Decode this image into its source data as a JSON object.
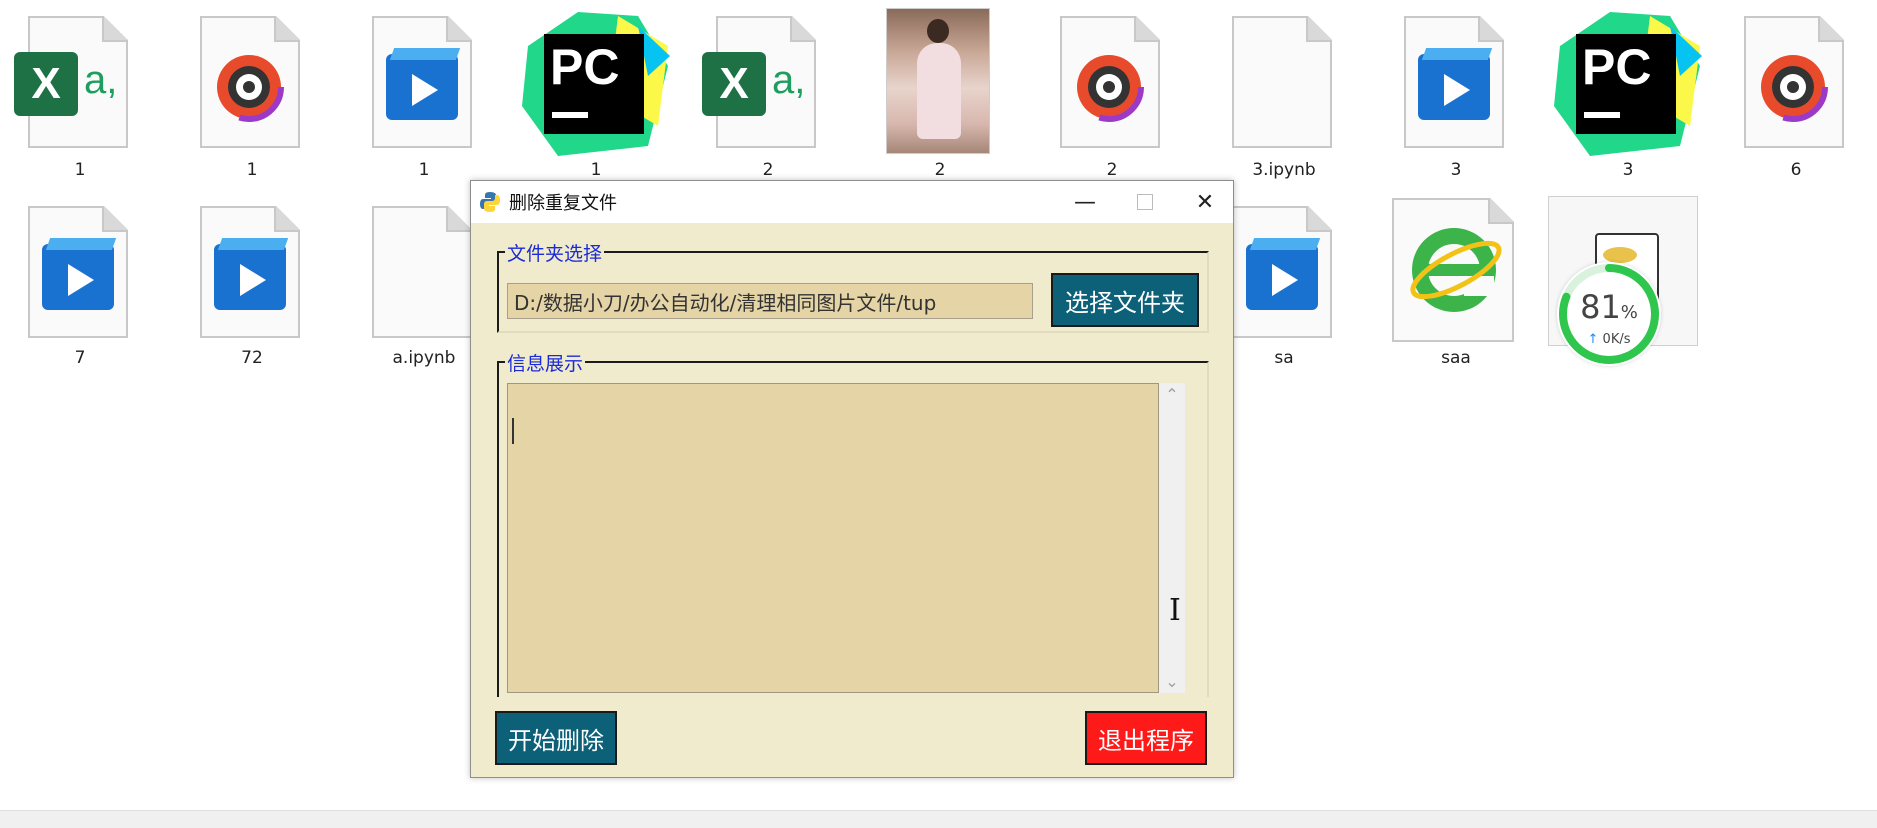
{
  "desktop": {
    "files": [
      {
        "label": "1",
        "icon": "excel-icon"
      },
      {
        "label": "1",
        "icon": "audio-icon"
      },
      {
        "label": "1",
        "icon": "video-icon"
      },
      {
        "label": "1",
        "icon": "pycharm-icon"
      },
      {
        "label": "2",
        "icon": "excel-icon"
      },
      {
        "label": "2",
        "icon": "photo-thumbnail"
      },
      {
        "label": "2",
        "icon": "audio-icon"
      },
      {
        "label": "3.ipynb",
        "icon": "blank-file-icon"
      },
      {
        "label": "3",
        "icon": "video-icon"
      },
      {
        "label": "3",
        "icon": "pycharm-icon"
      },
      {
        "label": "6",
        "icon": "audio-icon"
      },
      {
        "label": "7",
        "icon": "video-icon"
      },
      {
        "label": "72",
        "icon": "video-icon"
      },
      {
        "label": "a.ipynb",
        "icon": "blank-file-icon"
      },
      {
        "label": "sa",
        "icon": "video-icon"
      },
      {
        "label": "saa",
        "icon": "ie-icon"
      },
      {
        "label": "",
        "icon": "notepad-file-icon"
      }
    ]
  },
  "dialog": {
    "title": "删除重复文件",
    "folder_group_label": "文件夹选择",
    "folder_path": "D:/数据小刀/办公自动化/清理相同图片文件/tup",
    "select_folder_button": "选择文件夹",
    "info_group_label": "信息展示",
    "info_text": "",
    "start_button": "开始删除",
    "exit_button": "退出程序",
    "colors": {
      "teal_button": "#0c6078",
      "red_button": "#ff1a1a",
      "panel": "#f0ebcc",
      "field": "#e4d4a6",
      "legend": "#1c2bd8"
    }
  },
  "network_widget": {
    "percent": "81",
    "percent_unit": "%",
    "speed": "0K/s",
    "ring_fraction": 0.81,
    "ring_color": "#2fc64e"
  }
}
